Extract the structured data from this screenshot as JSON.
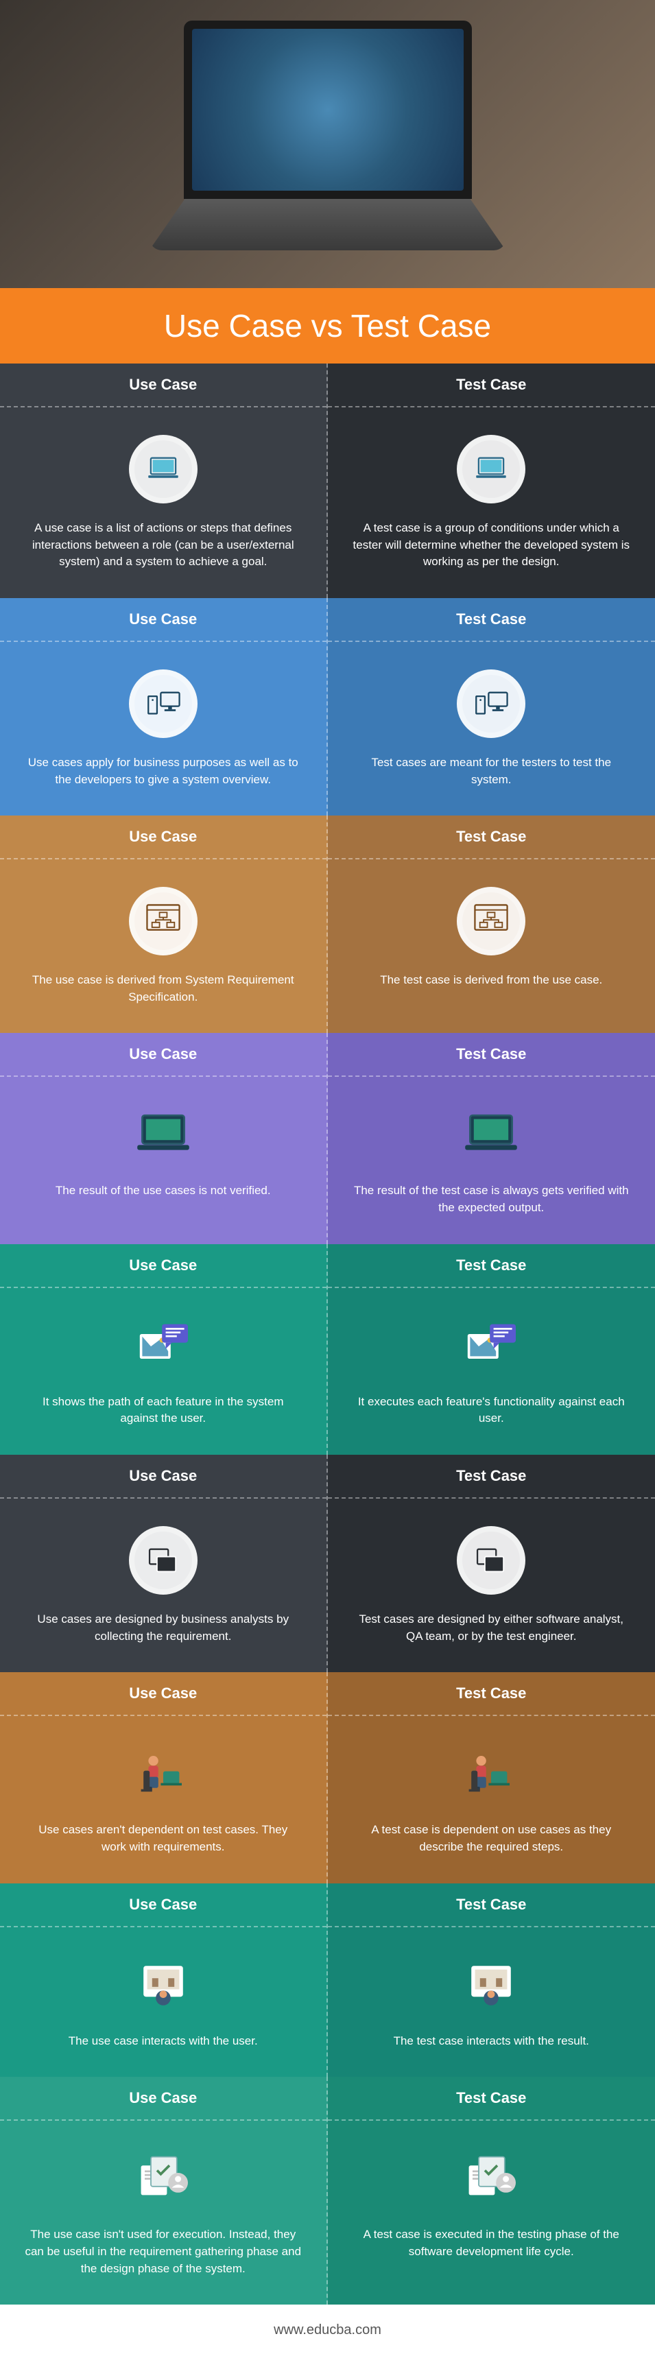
{
  "title": "Use Case vs Test Case",
  "left_label": "Use Case",
  "right_label": "Test Case",
  "rows": [
    {
      "use": "A use case is a list of actions or steps that defines interactions between a role (can be a user/external system) and a system to achieve a goal.",
      "test": "A test case is a group of conditions under which a tester will determine whether the developed system is working as per the design.",
      "icon": "laptop",
      "style": "circle",
      "colors": [
        "bg-dark-a",
        "bg-dark-b"
      ]
    },
    {
      "use": "Use cases apply for business purposes as well as to the developers to give a system overview.",
      "test": "Test cases are meant for the testers to test the system.",
      "icon": "desktop",
      "style": "circle",
      "colors": [
        "bg-blue-a",
        "bg-blue-b"
      ]
    },
    {
      "use": "The use case is derived from System Requirement Specification.",
      "test": "The test case is derived from the use case.",
      "icon": "sitemap",
      "style": "circle",
      "colors": [
        "bg-brown-a",
        "bg-brown-b"
      ]
    },
    {
      "use": "The result of the use cases is not verified.",
      "test": "The result of the test case is always gets verified with the expected output.",
      "icon": "laptop-flat",
      "style": "flat",
      "colors": [
        "bg-purple-a",
        "bg-purple-b"
      ]
    },
    {
      "use": "It shows the path of each feature in the system against the user.",
      "test": "It executes each feature's functionality against each user.",
      "icon": "chat-img",
      "style": "flat",
      "colors": [
        "bg-teal-a",
        "bg-teal-b"
      ]
    },
    {
      "use": "Use cases are designed by business analysts by collecting the requirement.",
      "test": "Test cases are designed by either software analyst, QA team, or by the test engineer.",
      "icon": "windows",
      "style": "circle",
      "colors": [
        "bg-dark-a",
        "bg-dark-b"
      ]
    },
    {
      "use": "Use cases aren't dependent on test cases. They work with requirements.",
      "test": "A test case is dependent on use cases as they describe the required steps.",
      "icon": "person-sit",
      "style": "flat",
      "colors": [
        "bg-brown2-a",
        "bg-brown2-b"
      ]
    },
    {
      "use": "The use case interacts with the user.",
      "test": "The test case interacts with the result.",
      "icon": "person-top",
      "style": "flat",
      "colors": [
        "bg-teal-a",
        "bg-teal-b"
      ]
    },
    {
      "use": "The use case isn't used for execution. Instead, they can be useful in the requirement gathering phase and the design phase of the system.",
      "test": "A test case is executed in the testing phase of the software development life cycle.",
      "icon": "papers",
      "style": "flat",
      "colors": [
        "bg-teal2-a",
        "bg-teal2-b"
      ]
    }
  ],
  "footer": "www.educba.com"
}
